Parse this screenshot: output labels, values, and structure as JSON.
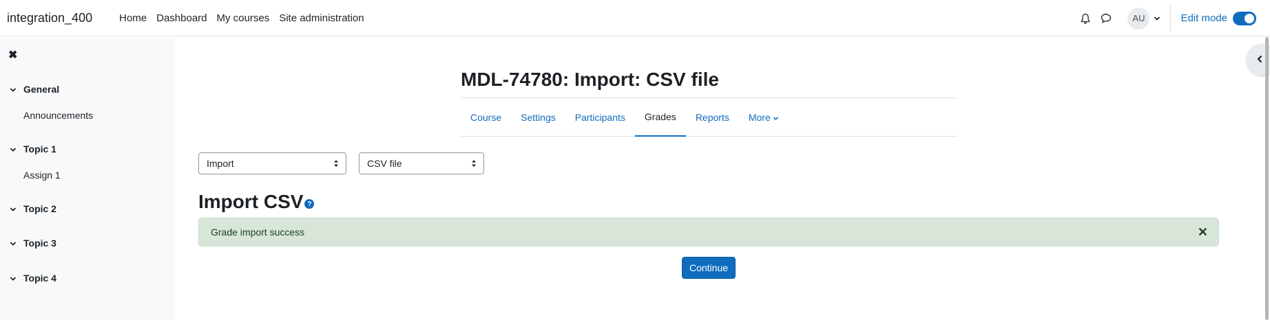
{
  "navbar": {
    "brand": "integration_400",
    "primary": [
      "Home",
      "Dashboard",
      "My courses",
      "Site administration"
    ],
    "avatar_initials": "AU",
    "edit_mode_label": "Edit mode",
    "edit_mode_on": true
  },
  "drawer": {
    "close_icon": "close-icon",
    "sections": [
      {
        "label": "General",
        "items": [
          "Announcements"
        ]
      },
      {
        "label": "Topic 1",
        "items": [
          "Assign 1"
        ]
      },
      {
        "label": "Topic 2",
        "items": []
      },
      {
        "label": "Topic 3",
        "items": []
      },
      {
        "label": "Topic 4",
        "items": []
      }
    ]
  },
  "page": {
    "title": "MDL-74780: Import: CSV file",
    "tabs": [
      {
        "label": "Course"
      },
      {
        "label": "Settings"
      },
      {
        "label": "Participants"
      },
      {
        "label": "Grades",
        "active": true
      },
      {
        "label": "Reports"
      },
      {
        "label": "More"
      }
    ],
    "select_action": "Import",
    "select_type": "CSV file",
    "heading": "Import CSV",
    "help_icon": "?",
    "alert": "Grade import success",
    "continue_label": "Continue"
  },
  "colors": {
    "primary": "#0f6cbf",
    "alert_bg": "#d7e6d9",
    "drawer_bg": "#f8f9fa"
  }
}
